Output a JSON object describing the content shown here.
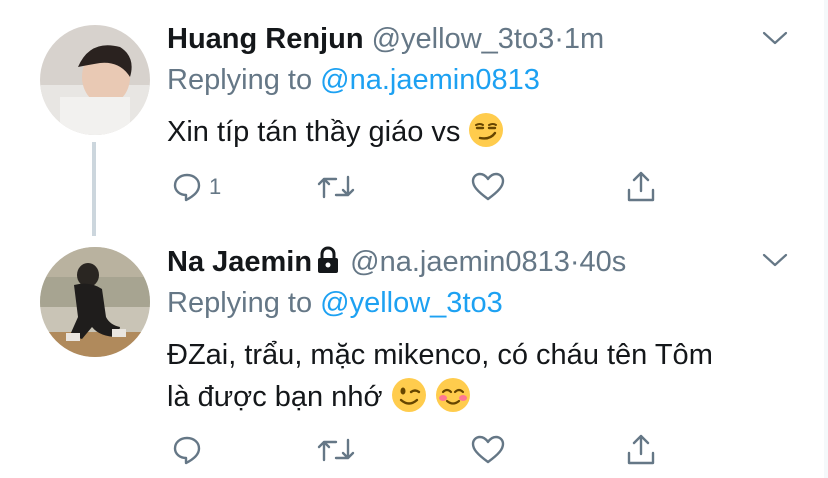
{
  "tweets": [
    {
      "name": "Huang Renjun",
      "handle": "@yellow_3to3",
      "separator": "·",
      "time": "1m",
      "replying_prefix": "Replying to",
      "replying_to": "@na.jaemin0813",
      "text": "Xin típ tán thầy giáo vs",
      "reply_count": "1",
      "emoji": [
        "smirk-emoji"
      ]
    },
    {
      "name": "Na Jaemin",
      "handle": "@na.jaemin0813",
      "separator": "·",
      "time": "40s",
      "replying_prefix": "Replying to",
      "replying_to": "@yellow_3to3",
      "text_line1": "ĐZai, trẩu, mặc mikenco, có cháu tên Tôm",
      "text_line2": "là được bạn nhớ",
      "reply_count": "",
      "emoji": [
        "wink-emoji",
        "smiling-blush-emoji"
      ]
    }
  ],
  "colors": {
    "link": "#1da1f2",
    "muted": "#657786",
    "text": "#14171a",
    "line": "#ccd6dd"
  }
}
